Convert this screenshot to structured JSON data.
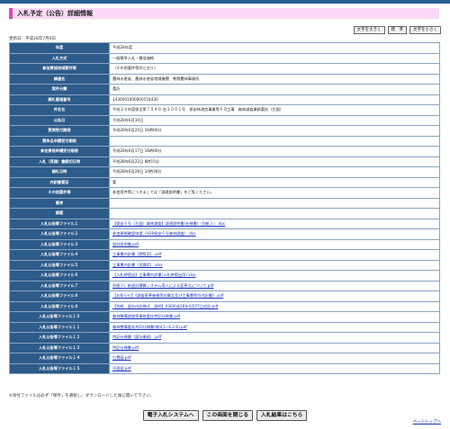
{
  "page": {
    "title": "入札予定（公告）詳細情報",
    "updated": "更新日：平成28年7月6日",
    "note": "※添付ファイルは必ず「保存」を選択し、ダウンロードした後に開いて下さい。",
    "page_top": "ページトップへ"
  },
  "font_controls": [
    "文字を大きく",
    "標　準",
    "文字を小さく"
  ],
  "rows": [
    {
      "label": "年度",
      "value": "平成28年度"
    },
    {
      "label": "入札方式",
      "value": "一般競争入札・最低価格"
    },
    {
      "label": "参加資格地域要件等",
      "value": "（その他要件等のとおり）"
    },
    {
      "label": "調達名",
      "value": "農林水産省、農林水産省地域機関　熊野農林事務所"
    },
    {
      "label": "案件分類",
      "value": "委託"
    },
    {
      "label": "開札管理番号",
      "value": "1430001000000154430"
    },
    {
      "label": "件名名",
      "value": "平成２８年度保全第７０４０-台２００１号　保安林改良事業等６号工事　森林調査業務委託（左図）"
    },
    {
      "label": "公告日",
      "value": "平成28年6月10日"
    },
    {
      "label": "質問受付期限",
      "value": "平成28年6月20日 16時00分"
    },
    {
      "label": "競争品申請受付期限",
      "value": ""
    },
    {
      "label": "参加資格申請受付期限",
      "value": "平成28年6月17日 16時00分"
    },
    {
      "label": "入札（見積）書締切日時",
      "value": "平成28年6月22日 8時15分"
    },
    {
      "label": "開札日時",
      "value": "平成28年6月28日 10時30分"
    },
    {
      "label": "内訳書要否",
      "value": "要"
    },
    {
      "label": "その他要件等",
      "value": "参加用件等につきましては「調達説明書」をご覧ください。"
    },
    {
      "label": "備考",
      "value": ""
    },
    {
      "label": "摘要",
      "value": ""
    },
    {
      "label": "入札公告等ファイル１",
      "value": "【保安６号（左図）森林調査】調達説明書(仕様書)（別紙１）.doc",
      "link": true
    },
    {
      "label": "入札公告等ファイル２",
      "value": "参加資格確認申請（H28保安６号森林調査）.doc",
      "link": true
    },
    {
      "label": "入札公告等ファイル３",
      "value": "設計説明書.pdf",
      "link": true
    },
    {
      "label": "入札公告等ファイル４",
      "value": "工事費内訳書（閲覧用）.pdf",
      "link": true
    },
    {
      "label": "入札公告等ファイル５",
      "value": "工事費内訳書（見積用）.xlsx",
      "link": true
    },
    {
      "label": "入札公告等ファイル６",
      "value": "【入札時提出】工事費内訳書(入札時提出用).xlsx",
      "link": true
    },
    {
      "label": "入札公告等ファイル７",
      "value": "別紙１）新設計積算システム導入による変更点について.pdf",
      "link": true
    },
    {
      "label": "入札公告等ファイル８",
      "value": "【お知らせ】《調査基準価格等の算定及び工事費等の内訳書》.pdf",
      "link": true
    },
    {
      "label": "入札公告等ファイル９",
      "value": "【別紙　設計内訳様式　説明】030平成28年4月27日追記.pdf",
      "link": true
    },
    {
      "label": "入札公告等ファイル１０",
      "value": "森林整備調査等業務委託特記仕様書.pdf",
      "link": true
    },
    {
      "label": "入札公告等ファイル１１",
      "value": "森林整備委託共同仕様書(様式1~4,2-6).pdf",
      "link": true
    },
    {
      "label": "入札公告等ファイル１２",
      "value": "特記仕様書（設計業務）.pdf",
      "link": true
    },
    {
      "label": "入札公告等ファイル１３",
      "value": "特記仕様書.pdf",
      "link": true
    },
    {
      "label": "入札公告等ファイル１４",
      "value": "位置図.pdf",
      "link": true
    },
    {
      "label": "入札公告等ファイル１５",
      "value": "平面図.pdf",
      "link": true
    }
  ],
  "buttons": [
    "電子入札システムへ",
    "この画面を閉じる",
    "入札結果はこちら"
  ]
}
